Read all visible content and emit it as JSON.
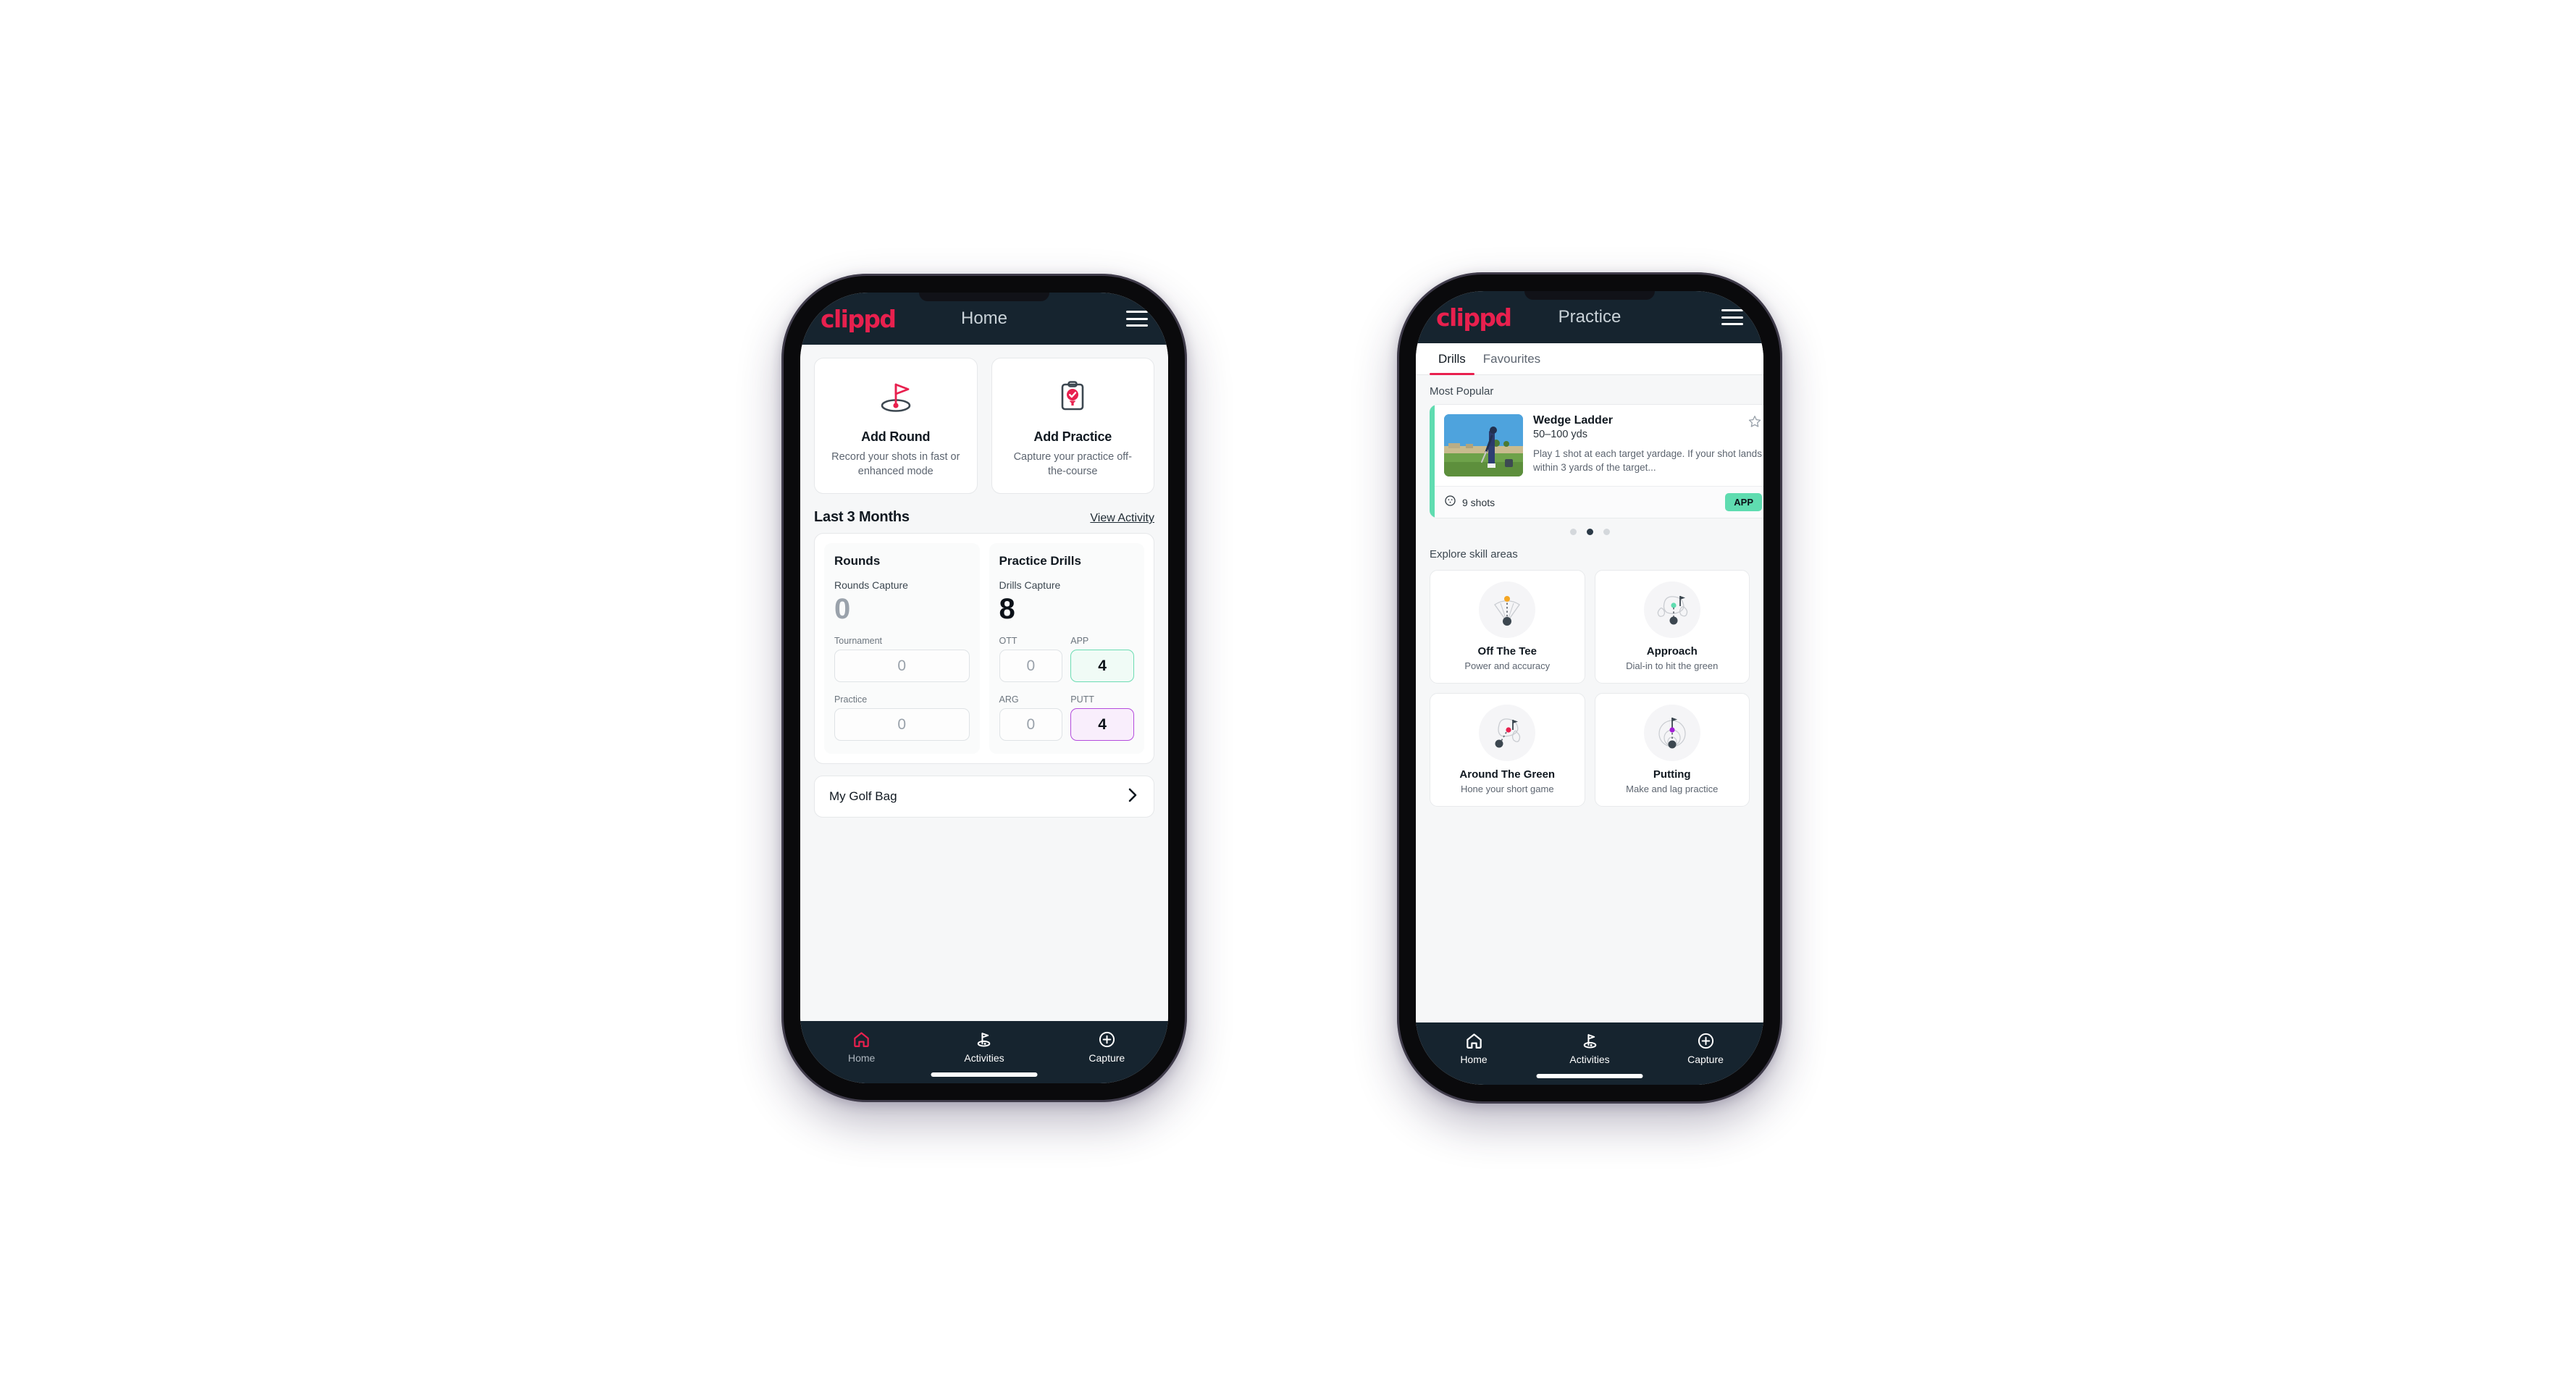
{
  "brand": {
    "logo_text": "clippd",
    "accent_pink": "#e8204e",
    "dark_navy": "#16242f",
    "mint": "#5fdcb0",
    "purple": "#a21fd4"
  },
  "phone_home": {
    "appbar": {
      "title": "Home",
      "menu_icon": "hamburger-icon"
    },
    "actions": [
      {
        "icon": "golf-flag-hole-icon",
        "title": "Add Round",
        "desc": "Record your shots in fast or enhanced mode"
      },
      {
        "icon": "clipboard-check-tee-icon",
        "title": "Add Practice",
        "desc": "Capture your practice off-the-course"
      }
    ],
    "section": {
      "title": "Last 3 Months",
      "link": "View Activity"
    },
    "stats": {
      "rounds": {
        "title": "Rounds",
        "capture_label": "Rounds Capture",
        "capture_value": "0",
        "fields": [
          {
            "label": "Tournament",
            "value": "0",
            "accent": "none"
          },
          {
            "label": "Practice",
            "value": "0",
            "accent": "none"
          }
        ]
      },
      "drills": {
        "title": "Practice Drills",
        "capture_label": "Drills Capture",
        "capture_value": "8",
        "fields": [
          {
            "label": "OTT",
            "value": "0",
            "accent": "none"
          },
          {
            "label": "APP",
            "value": "4",
            "accent": "green"
          },
          {
            "label": "ARG",
            "value": "0",
            "accent": "none"
          },
          {
            "label": "PUTT",
            "value": "4",
            "accent": "purple"
          }
        ]
      }
    },
    "golf_bag": {
      "label": "My Golf Bag",
      "chevron_icon": "chevron-right-icon"
    },
    "bottom_nav": [
      {
        "label": "Home",
        "icon": "home-icon",
        "active": true
      },
      {
        "label": "Activities",
        "icon": "golf-flag-icon",
        "active": false
      },
      {
        "label": "Capture",
        "icon": "plus-circle-icon",
        "active": false
      }
    ]
  },
  "phone_practice": {
    "appbar": {
      "title": "Practice",
      "menu_icon": "hamburger-icon"
    },
    "tabs": [
      {
        "label": "Drills",
        "active": true
      },
      {
        "label": "Favourites",
        "active": false
      }
    ],
    "most_popular_label": "Most Popular",
    "drill": {
      "title": "Wedge Ladder",
      "yardage": "50–100 yds",
      "description": "Play 1 shot at each target yardage. If your shot lands within 3 yards of the target...",
      "shots": "9 shots",
      "shots_icon": "target-circle-icon",
      "badge": "APP",
      "favourite_icon": "star-outline-icon",
      "accent_color": "#5fdcb0",
      "thumbnail": "golfer-chipping-photo"
    },
    "carousel_dots": {
      "count": 3,
      "active_index": 1
    },
    "skill_section_label": "Explore skill areas",
    "skills": [
      {
        "title": "Off The Tee",
        "sub": "Power and accuracy",
        "icon": "tee-fan-icon",
        "dot_color": "#f5a623"
      },
      {
        "title": "Approach",
        "sub": "Dial-in to hit the green",
        "icon": "green-flag-icon",
        "dot_color": "#5fdcb0"
      },
      {
        "title": "Around The Green",
        "sub": "Hone your short game",
        "icon": "chip-green-icon",
        "dot_color": "#e8204e"
      },
      {
        "title": "Putting",
        "sub": "Make and lag practice",
        "icon": "putting-rings-icon",
        "dot_color": "#a21fd4"
      }
    ],
    "bottom_nav": [
      {
        "label": "Home",
        "icon": "home-icon",
        "active": false
      },
      {
        "label": "Activities",
        "icon": "golf-flag-icon",
        "active": false
      },
      {
        "label": "Capture",
        "icon": "plus-circle-icon",
        "active": false
      }
    ]
  }
}
